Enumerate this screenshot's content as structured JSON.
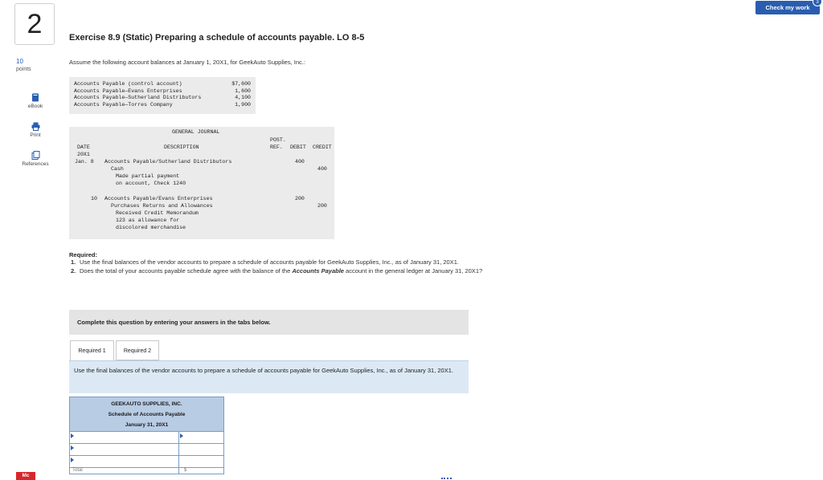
{
  "question": {
    "number": "2",
    "points_value": "10",
    "points_label": "points"
  },
  "side_tools": [
    {
      "label": "eBook",
      "icon": "book-icon"
    },
    {
      "label": "Print",
      "icon": "printer-icon"
    },
    {
      "label": "References",
      "icon": "references-icon"
    }
  ],
  "header": {
    "check_button": "Check my work",
    "check_badge": "3"
  },
  "exercise": {
    "title": "Exercise 8.9 (Static) Preparing a schedule of accounts payable. LO 8-5",
    "intro": "Assume the following account balances at January 1, 20X1, for GeekAuto Supplies, Inc.:"
  },
  "balances": [
    {
      "account": "Accounts Payable (control account)",
      "amount": "$7,600"
    },
    {
      "account": "Accounts Payable—Evans Enterprises",
      "amount": "1,600"
    },
    {
      "account": "Accounts Payable—Sutherland Distributors",
      "amount": "4,100"
    },
    {
      "account": "Accounts Payable—Torres Company",
      "amount": "1,900"
    }
  ],
  "journal": {
    "title": "GENERAL JOURNAL",
    "col_date": "DATE",
    "col_desc": "DESCRIPTION",
    "col_post": "POST.",
    "col_ref": "REF.",
    "col_debit": "DEBIT",
    "col_credit": "CREDIT",
    "year": "20X1",
    "entry1": {
      "date": "Jan.  8",
      "debit_account": "Accounts Payable/Sutherland Distributors",
      "credit_account": "Cash",
      "memo1": "Made partial payment",
      "memo2": "on account, Check 1240",
      "debit": "400",
      "credit": "400"
    },
    "entry2": {
      "date": "10",
      "debit_account": "Accounts Payable/Evans Enterprises",
      "credit_account": "Purchases Returns and Allowances",
      "memo1": "Received Credit Memorandum",
      "memo2": "123 as allowance for",
      "memo3": "discolored merchandise",
      "debit": "200",
      "credit": "200"
    }
  },
  "required": {
    "heading": "Required:",
    "items": [
      {
        "num": "1.",
        "text": "Use the final balances of the vendor accounts to prepare a schedule of accounts payable for GeekAuto Supplies, Inc., as of January 31, 20X1."
      },
      {
        "num": "2.",
        "text_before": "Does the total of your accounts payable schedule agree with the balance of the ",
        "text_emph": "Accounts Payable",
        "text_after": " account in the general ledger at January 31, 20X1?"
      }
    ]
  },
  "complete_box": "Complete this question by entering your answers in the tabs below.",
  "tabs": [
    "Required 1",
    "Required 2"
  ],
  "instruction": "Use the final balances of the vendor accounts to prepare a schedule of accounts payable for GeekAuto Supplies, Inc., as of January 31, 20X1.",
  "schedule": {
    "company": "GEEKAUTO SUPPLIES, INC.",
    "name": "Schedule of Accounts Payable",
    "date": "January 31, 20X1",
    "cut_label": "Total",
    "cut_symbol": "$"
  },
  "logo": "Mc"
}
